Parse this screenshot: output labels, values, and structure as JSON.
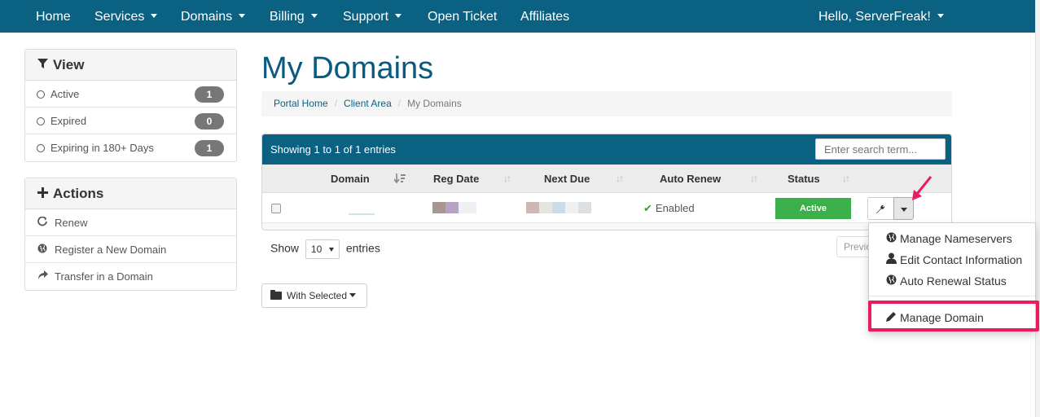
{
  "nav": {
    "items": [
      {
        "label": "Home",
        "dropdown": false
      },
      {
        "label": "Services",
        "dropdown": true
      },
      {
        "label": "Domains",
        "dropdown": true
      },
      {
        "label": "Billing",
        "dropdown": true
      },
      {
        "label": "Support",
        "dropdown": true
      },
      {
        "label": "Open Ticket",
        "dropdown": false
      },
      {
        "label": "Affiliates",
        "dropdown": false
      }
    ],
    "user_label": "Hello, ServerFreak!"
  },
  "sidebar": {
    "view": {
      "title": "View",
      "icon": "filter-icon",
      "items": [
        {
          "label": "Active",
          "count": "1"
        },
        {
          "label": "Expired",
          "count": "0"
        },
        {
          "label": "Expiring in 180+ Days",
          "count": "1"
        }
      ]
    },
    "actions": {
      "title": "Actions",
      "icon": "plus-icon",
      "items": [
        {
          "label": "Renew",
          "icon": "refresh-icon"
        },
        {
          "label": "Register a New Domain",
          "icon": "globe-icon"
        },
        {
          "label": "Transfer in a Domain",
          "icon": "share-arrow-icon"
        }
      ]
    }
  },
  "page": {
    "title": "My Domains",
    "breadcrumb": [
      "Portal Home",
      "Client Area",
      "My Domains"
    ]
  },
  "table": {
    "info": "Showing 1 to 1 of 1 entries",
    "search_placeholder": "Enter search term...",
    "columns": [
      "Domain",
      "Reg Date",
      "Next Due",
      "Auto Renew",
      "Status"
    ],
    "row": {
      "auto_renew": "Enabled",
      "status": "Active"
    },
    "show_label": "Show",
    "entries_label": "entries",
    "page_size": "10",
    "prev_label": "Previous",
    "with_selected_label": "With Selected"
  },
  "dropdown": {
    "items": [
      {
        "label": "Manage Nameservers",
        "icon": "globe-icon"
      },
      {
        "label": "Edit Contact Information",
        "icon": "user-icon"
      },
      {
        "label": "Auto Renewal Status",
        "icon": "globe-icon"
      },
      {
        "label": "Manage Domain",
        "icon": "pencil-icon"
      }
    ]
  },
  "colors": {
    "brand": "#0a6182",
    "status_active": "#3bb04a",
    "highlight": "#ee1a5c"
  }
}
